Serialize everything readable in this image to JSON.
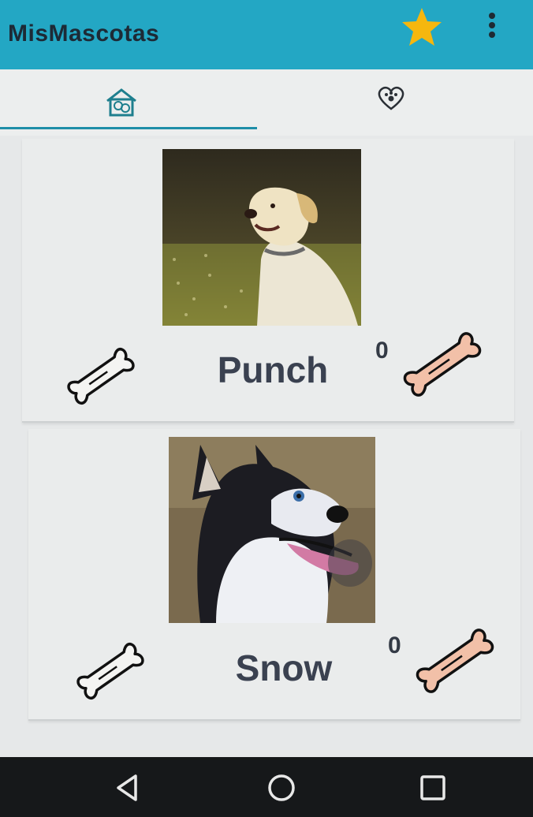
{
  "app": {
    "title": "MisMascotas",
    "accent": "#23a7c4",
    "star_color": "#f6b70e"
  },
  "appbar": {
    "icons": [
      "star-icon",
      "overflow-menu-icon"
    ]
  },
  "tabs": [
    {
      "icon": "pets-house-icon",
      "selected": true
    },
    {
      "icon": "heart-paw-icon",
      "selected": false
    }
  ],
  "pets": [
    {
      "name": "Punch",
      "likes": "0",
      "photo": "yellow-labrador-photo"
    },
    {
      "name": "Snow",
      "likes": "0",
      "photo": "husky-puppy-photo"
    }
  ],
  "icons": {
    "like_action": "bone-outline-icon",
    "like_count": "bone-filled-icon",
    "bone_fill": "#f2c0a8"
  },
  "navbar": {
    "icons": [
      "back-icon",
      "home-icon",
      "recents-icon"
    ]
  }
}
